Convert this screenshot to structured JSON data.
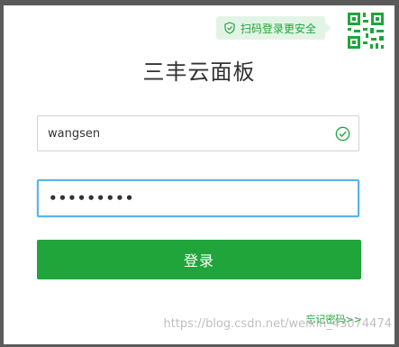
{
  "scan_tip": {
    "text": "扫码登录更安全",
    "icon": "shield-check-icon"
  },
  "qr_toggle": {
    "icon": "qr-code-icon"
  },
  "title": "三丰云面板",
  "username": {
    "value": "wangsen",
    "status_icon": "check-circle-icon"
  },
  "password": {
    "value": "abcdefghi"
  },
  "login_button": {
    "label": "登录"
  },
  "forgot_link": {
    "label": "忘记密码>>"
  },
  "watermark": "https://blog.csdn.net/weixin_43074474",
  "colors": {
    "accent": "#20a53a",
    "focus_border": "#5ab2ef",
    "tip_background": "#e3f4e7"
  }
}
